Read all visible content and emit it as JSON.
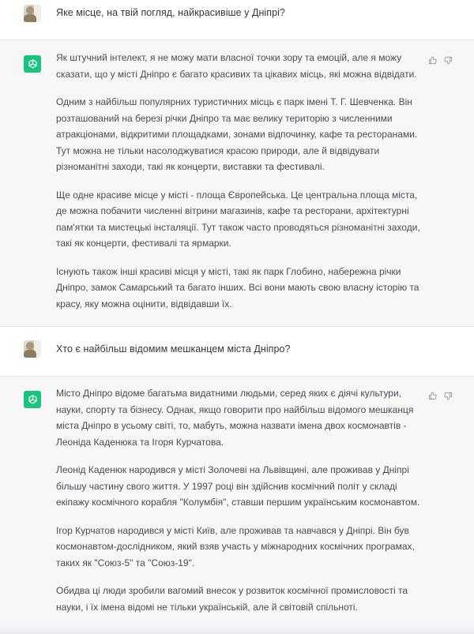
{
  "conversation": {
    "q1": "Яке місце, на твій погляд, найкрасивіше у Дніпрі?",
    "a1": [
      "Як штучний інтелект, я не можу мати власної точки зору та емоцій, але я можу сказати, що у місті Дніпро є багато красивих та цікавих місць, які можна відвідати.",
      "Одним з найбільш популярних туристичних місць є парк імені Т. Г. Шевченка. Він розташований на березі річки Дніпро та має велику територію з численними атракціонами, відкритими площадками, зонами відпочинку, кафе та ресторанами. Тут можна не тільки насолоджуватися красою природи, але й відвідувати різноманітні заходи, такі як концерти, виставки та фестивалі.",
      "Ще одне красиве місце у місті - площа Європейська. Це центральна площа міста, де можна побачити численні вітрини магазинів, кафе та ресторани, архітектурні пам'ятки та мистецькі інсталяції. Тут також часто проводяться різноманітні заходи, такі як концерти, фестивалі та ярмарки.",
      "Існують також інші красиві місця у місті, такі як парк Глобино, набережна річки Дніпро, замок Самарський та багато інших. Всі вони мають свою власну історію та красу, яку можна оцінити, відвідавши їх."
    ],
    "q2": "Хто є найбільш відомим мешканцем міста Дніпро?",
    "a2": [
      "Місто Дніпро відоме багатьма видатними людьми, серед яких є діячі культури, науки, спорту та бізнесу. Однак, якщо говорити про найбільш відомого мешканця міста Дніпро в усьому світі, то, мабуть, можна назвати імена двох космонавтів - Леоніда Каденюка та Ігоря Курчатова.",
      "Леонід Каденюк народився у місті Золочеві на Львівщині, але проживав у Дніпрі більшу частину свого життя. У 1997 році він здійснив космічний політ у складі екіпажу космічного корабля \"Колумбія\", ставши першим українським космонавтом.",
      "Ігор Курчатов народився у місті Київ, але проживав та навчався у Дніпрі. Він був космонавтом-дослідником, який взяв участь у міжнародних космічних програмах, таких як \"Союз-5\" та \"Союз-19\".",
      "Обидва ці люди зробили вагомий внесок у розвиток космічної промисловості та науки, і їх імена відомі не тільки українській, але й світовій спільноті."
    ]
  },
  "icons": {
    "user_avatar": "user-photo-avatar",
    "assistant_avatar": "openai-logo-icon",
    "like": "thumbs-up-icon",
    "dislike": "thumbs-down-icon"
  },
  "colors": {
    "assistant_bg": "#f7f7f8",
    "logo_bg": "#19c37d",
    "text": "#4b4b55"
  }
}
